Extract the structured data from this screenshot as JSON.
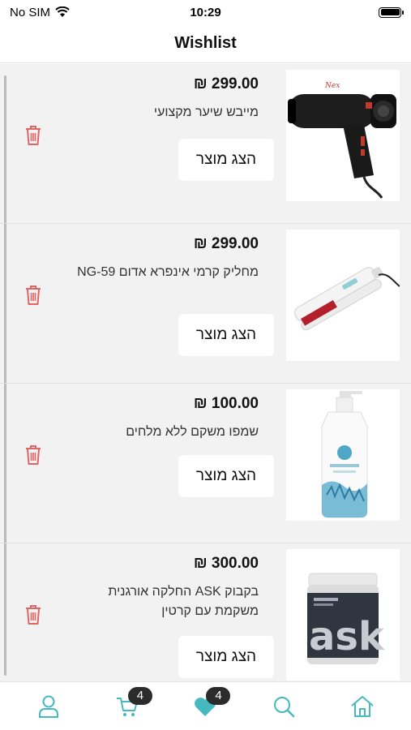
{
  "status_bar": {
    "carrier": "No SIM",
    "time": "10:29"
  },
  "header": {
    "title": "Wishlist"
  },
  "colors": {
    "accent": "#46b8bf",
    "trash": "#e06666",
    "list_background": "#f2f2f2"
  },
  "items": [
    {
      "price": "₪ 299.00",
      "name": "מייבש שיער מקצועי",
      "button_label": "הצג מוצר",
      "image": "hair-dryer"
    },
    {
      "price": "₪ 299.00",
      "name": "מחליק קרמי אינפרא אדום NG-59",
      "button_label": "הצג מוצר",
      "image": "hair-straightener"
    },
    {
      "price": "₪ 100.00",
      "name": "שמפו משקם ללא מלחים",
      "button_label": "הצג מוצר",
      "image": "shampoo-bottle"
    },
    {
      "price": "₪ 300.00",
      "name": "בקבוק ASK החלקה אורגנית משקמת עם קרטין",
      "button_label": "הצג מוצר",
      "image": "keratin-jar"
    }
  ],
  "bottom_nav": {
    "cart_badge": "4",
    "wishlist_badge": "4",
    "tabs": [
      "profile-icon",
      "cart-icon",
      "heart-icon",
      "search-icon",
      "home-icon"
    ]
  }
}
